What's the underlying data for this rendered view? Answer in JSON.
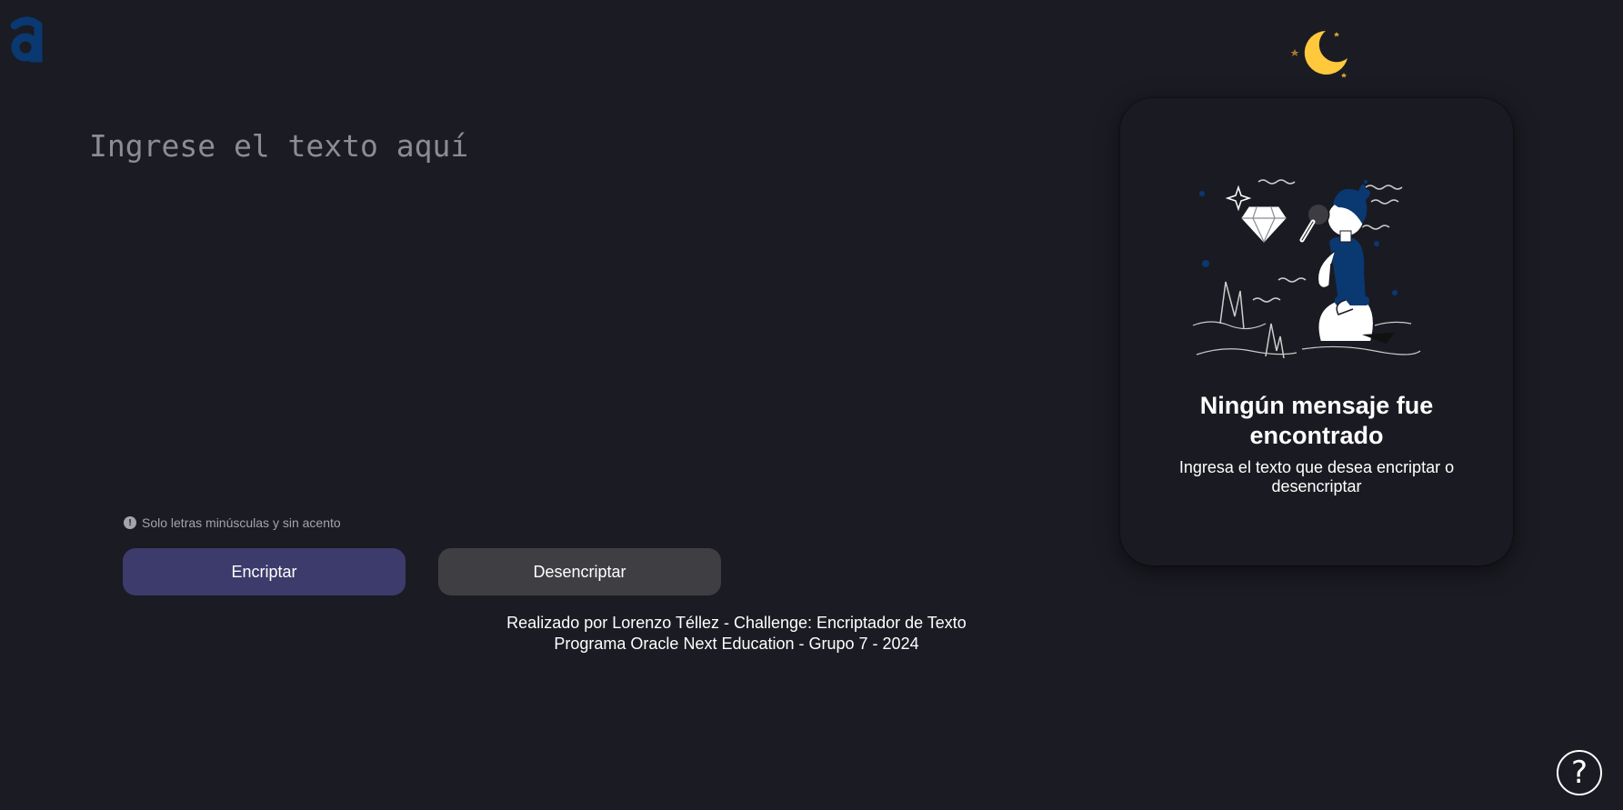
{
  "brand": {
    "logo_icon": "alura-logo-icon",
    "accent_color": "#0a3871"
  },
  "theme_toggle": {
    "icon": "moon-stars-icon",
    "moon_color": "#ffc83d"
  },
  "input": {
    "placeholder": "Ingrese el texto aquí",
    "value": ""
  },
  "hint": {
    "icon": "exclamation-circle-icon",
    "text": "Solo letras minúsculas y sin acento"
  },
  "buttons": {
    "encrypt_label": "Encriptar",
    "decrypt_label": "Desencriptar",
    "encrypt_color": "#3d3b6b",
    "decrypt_color": "#3f3f43"
  },
  "result": {
    "illustration": "person-with-magnifying-glass-illustration",
    "title": "Ningún mensaje fue encontrado",
    "subtitle": "Ingresa el texto que desea encriptar o desencriptar"
  },
  "footer": {
    "line1": "Realizado por Lorenzo Téllez - Challenge: Encriptador de Texto",
    "line2": "Programa Oracle Next Education - Grupo 7 - 2024"
  },
  "help": {
    "icon": "question-mark-icon",
    "label": "?"
  }
}
